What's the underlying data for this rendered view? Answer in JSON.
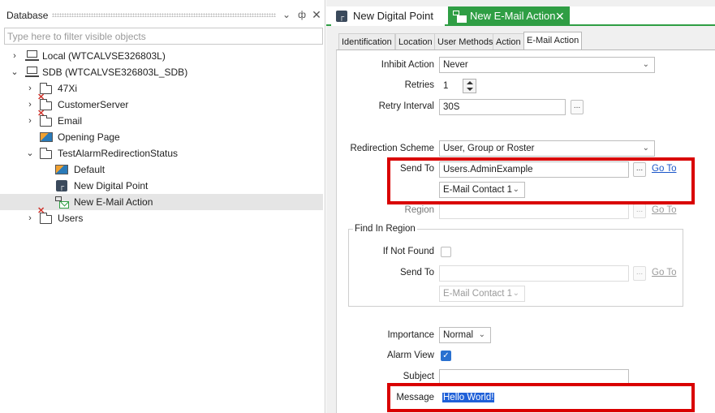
{
  "left_pane": {
    "title": "Database",
    "filter_placeholder": "Type here to filter visible objects",
    "tree": [
      {
        "label": "Local (WTCALVSE326803L)",
        "icon": "computer-icon"
      },
      {
        "label": "SDB (WTCALVSE326803L_SDB)",
        "icon": "computer-icon"
      },
      {
        "label": "47Xi",
        "icon": "folder-icon"
      },
      {
        "label": "CustomerServer",
        "icon": "folder-error-icon"
      },
      {
        "label": "Email",
        "icon": "folder-error-icon"
      },
      {
        "label": "Opening Page",
        "icon": "mimic-icon"
      },
      {
        "label": "TestAlarmRedirectionStatus",
        "icon": "folder-icon"
      },
      {
        "label": "Default",
        "icon": "mimic-icon"
      },
      {
        "label": "New Digital Point",
        "icon": "digital-point-icon"
      },
      {
        "label": "New E-Mail Action",
        "icon": "email-action-icon"
      },
      {
        "label": "Users",
        "icon": "folder-error-icon"
      }
    ]
  },
  "doc_tabs": [
    {
      "label": "New Digital Point"
    },
    {
      "label": "New E-Mail Action"
    }
  ],
  "prop_tabs": [
    "Identification",
    "Location",
    "User Methods",
    "Action",
    "E-Mail Action"
  ],
  "form": {
    "inhibit_action": {
      "label": "Inhibit Action",
      "value": "Never"
    },
    "retries": {
      "label": "Retries",
      "value": "1"
    },
    "retry_interval": {
      "label": "Retry Interval",
      "value": "30S"
    },
    "redirection_scheme": {
      "label": "Redirection Scheme",
      "value": "User, Group or Roster"
    },
    "send_to": {
      "label": "Send To",
      "value": "Users.AdminExample",
      "goto": "Go To",
      "contact": "E-Mail Contact 1"
    },
    "region": {
      "label": "Region",
      "value": "",
      "goto": "Go To"
    },
    "find_in_region": {
      "title": "Find In Region",
      "if_not_found": "If Not Found",
      "send_to_label": "Send To",
      "send_to_value": "",
      "goto": "Go To",
      "contact": "E-Mail Contact 1"
    },
    "importance": {
      "label": "Importance",
      "value": "Normal"
    },
    "alarm_view": {
      "label": "Alarm View",
      "checked": true
    },
    "subject": {
      "label": "Subject",
      "value": ""
    },
    "message": {
      "label": "Message",
      "value": "Hello World!"
    }
  },
  "colors": {
    "accent_green": "#2f9e44",
    "highlight_red": "#d90000",
    "link_blue": "#1a56c9"
  }
}
